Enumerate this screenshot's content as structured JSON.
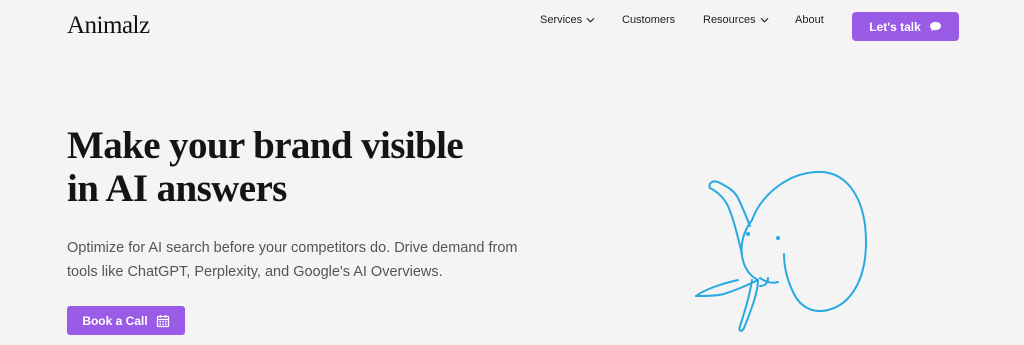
{
  "header": {
    "logo": "Animalz",
    "nav": [
      {
        "label": "Services",
        "dropdown": true
      },
      {
        "label": "Customers",
        "dropdown": false
      },
      {
        "label": "Resources",
        "dropdown": true
      },
      {
        "label": "About",
        "dropdown": false
      }
    ],
    "cta_label": "Let's talk",
    "cta_icon": "chat-bubble-icon"
  },
  "hero": {
    "title_line1": "Make your brand visible",
    "title_line2": "in AI answers",
    "subtitle_line1": "Optimize for AI search before your competitors do. Drive demand from",
    "subtitle_line2": "tools like ChatGPT, Perplexity, and Google's AI Overviews.",
    "button_label": "Book a Call",
    "button_icon": "calendar-icon",
    "illustration": "elephant-illustration"
  },
  "colors": {
    "background": "#f4f4f4",
    "accent": "#9a5ce6",
    "illustration_stroke": "#27a9e1"
  }
}
